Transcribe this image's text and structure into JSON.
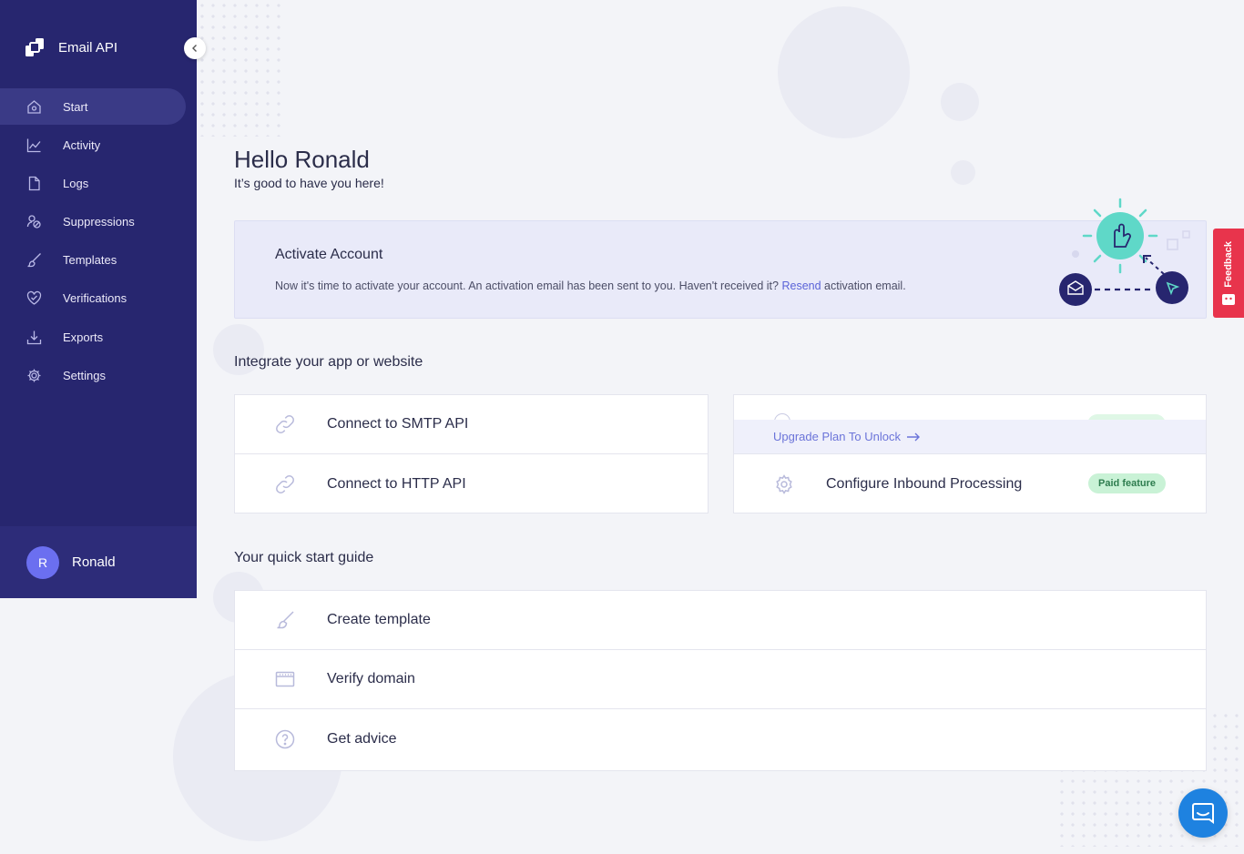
{
  "app": {
    "name": "Email API"
  },
  "sidebar": {
    "items": [
      {
        "label": "Start",
        "icon": "home-icon",
        "active": true
      },
      {
        "label": "Activity",
        "icon": "chart-line-icon",
        "active": false
      },
      {
        "label": "Logs",
        "icon": "file-icon",
        "active": false
      },
      {
        "label": "Suppressions",
        "icon": "suppressions-icon",
        "active": false
      },
      {
        "label": "Templates",
        "icon": "brush-icon",
        "active": false
      },
      {
        "label": "Verifications",
        "icon": "heart-check-icon",
        "active": false
      },
      {
        "label": "Exports",
        "icon": "download-icon",
        "active": false
      },
      {
        "label": "Settings",
        "icon": "gear-icon",
        "active": false
      }
    ],
    "user": {
      "initial": "R",
      "name": "Ronald"
    }
  },
  "greeting": {
    "title": "Hello Ronald",
    "subtitle": "It’s good to have you here!"
  },
  "activate": {
    "title": "Activate Account",
    "text_before": "Now it's time to activate your account. An activation email has been sent to you. Haven't received it?",
    "link": "Resend",
    "text_after": "activation email."
  },
  "integrate": {
    "title": "Integrate your app or website",
    "left": [
      {
        "label": "Connect to SMTP API",
        "icon": "link-icon"
      },
      {
        "label": "Connect to HTTP API",
        "icon": "link-icon"
      }
    ],
    "right": {
      "upgrade_label": "Upgrade Plan To Unlock",
      "rows": [
        {
          "label": "Configure Inbound Processing",
          "badge": "Paid feature",
          "icon": "gear-icon"
        }
      ]
    }
  },
  "guide": {
    "title": "Your quick start guide",
    "items": [
      {
        "label": "Create template",
        "icon": "brush-icon"
      },
      {
        "label": "Verify domain",
        "icon": "browser-window-icon"
      },
      {
        "label": "Get advice",
        "icon": "question-circle-icon"
      }
    ]
  },
  "feedback": {
    "label": "Feedback"
  },
  "colors": {
    "sidebar": "#27266f",
    "accent": "#5a63d8",
    "badge_bg": "#c9f2d6",
    "feedback": "#e8344c",
    "chat": "#1e82e0"
  }
}
